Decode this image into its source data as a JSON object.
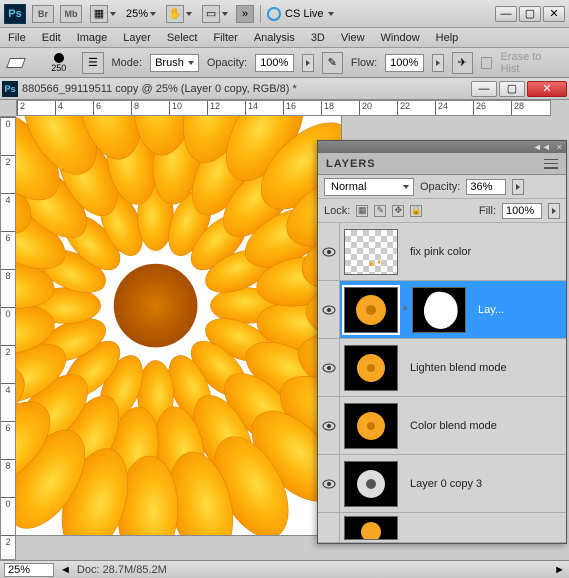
{
  "titlebar": {
    "ps": "Ps",
    "br": "Br",
    "mb": "Mb",
    "zoom": "25%",
    "cslive": "CS Live"
  },
  "menu": {
    "file": "File",
    "edit": "Edit",
    "image": "Image",
    "layer": "Layer",
    "select": "Select",
    "filter": "Filter",
    "analysis": "Analysis",
    "threeD": "3D",
    "view": "View",
    "window": "Window",
    "help": "Help"
  },
  "toolbar": {
    "brush_size": "250",
    "mode_label": "Mode:",
    "mode_value": "Brush",
    "opacity_label": "Opacity:",
    "opacity_value": "100%",
    "flow_label": "Flow:",
    "flow_value": "100%",
    "erase_history": "Erase to Hist"
  },
  "document": {
    "title": "880566_99119511 copy @ 25% (Layer 0 copy, RGB/8) *"
  },
  "ruler_h": [
    "2",
    "4",
    "6",
    "8",
    "10",
    "12",
    "14",
    "16",
    "18",
    "20",
    "22",
    "24",
    "26",
    "28"
  ],
  "ruler_v": [
    "0",
    "2",
    "4",
    "6",
    "8",
    "0",
    "2",
    "4",
    "6",
    "8",
    "0",
    "2"
  ],
  "status": {
    "zoom": "25%",
    "doc": "Doc: 28.7M/85.2M"
  },
  "panel": {
    "title": "LAYERS",
    "blend_mode": "Normal",
    "opacity_label": "Opacity:",
    "opacity_value": "36%",
    "lock_label": "Lock:",
    "fill_label": "Fill:",
    "fill_value": "100%",
    "layers": [
      {
        "name": "fix pink color"
      },
      {
        "name": "Lay..."
      },
      {
        "name": "Lighten blend mode"
      },
      {
        "name": "Color blend mode"
      },
      {
        "name": "Layer 0 copy 3"
      }
    ]
  }
}
